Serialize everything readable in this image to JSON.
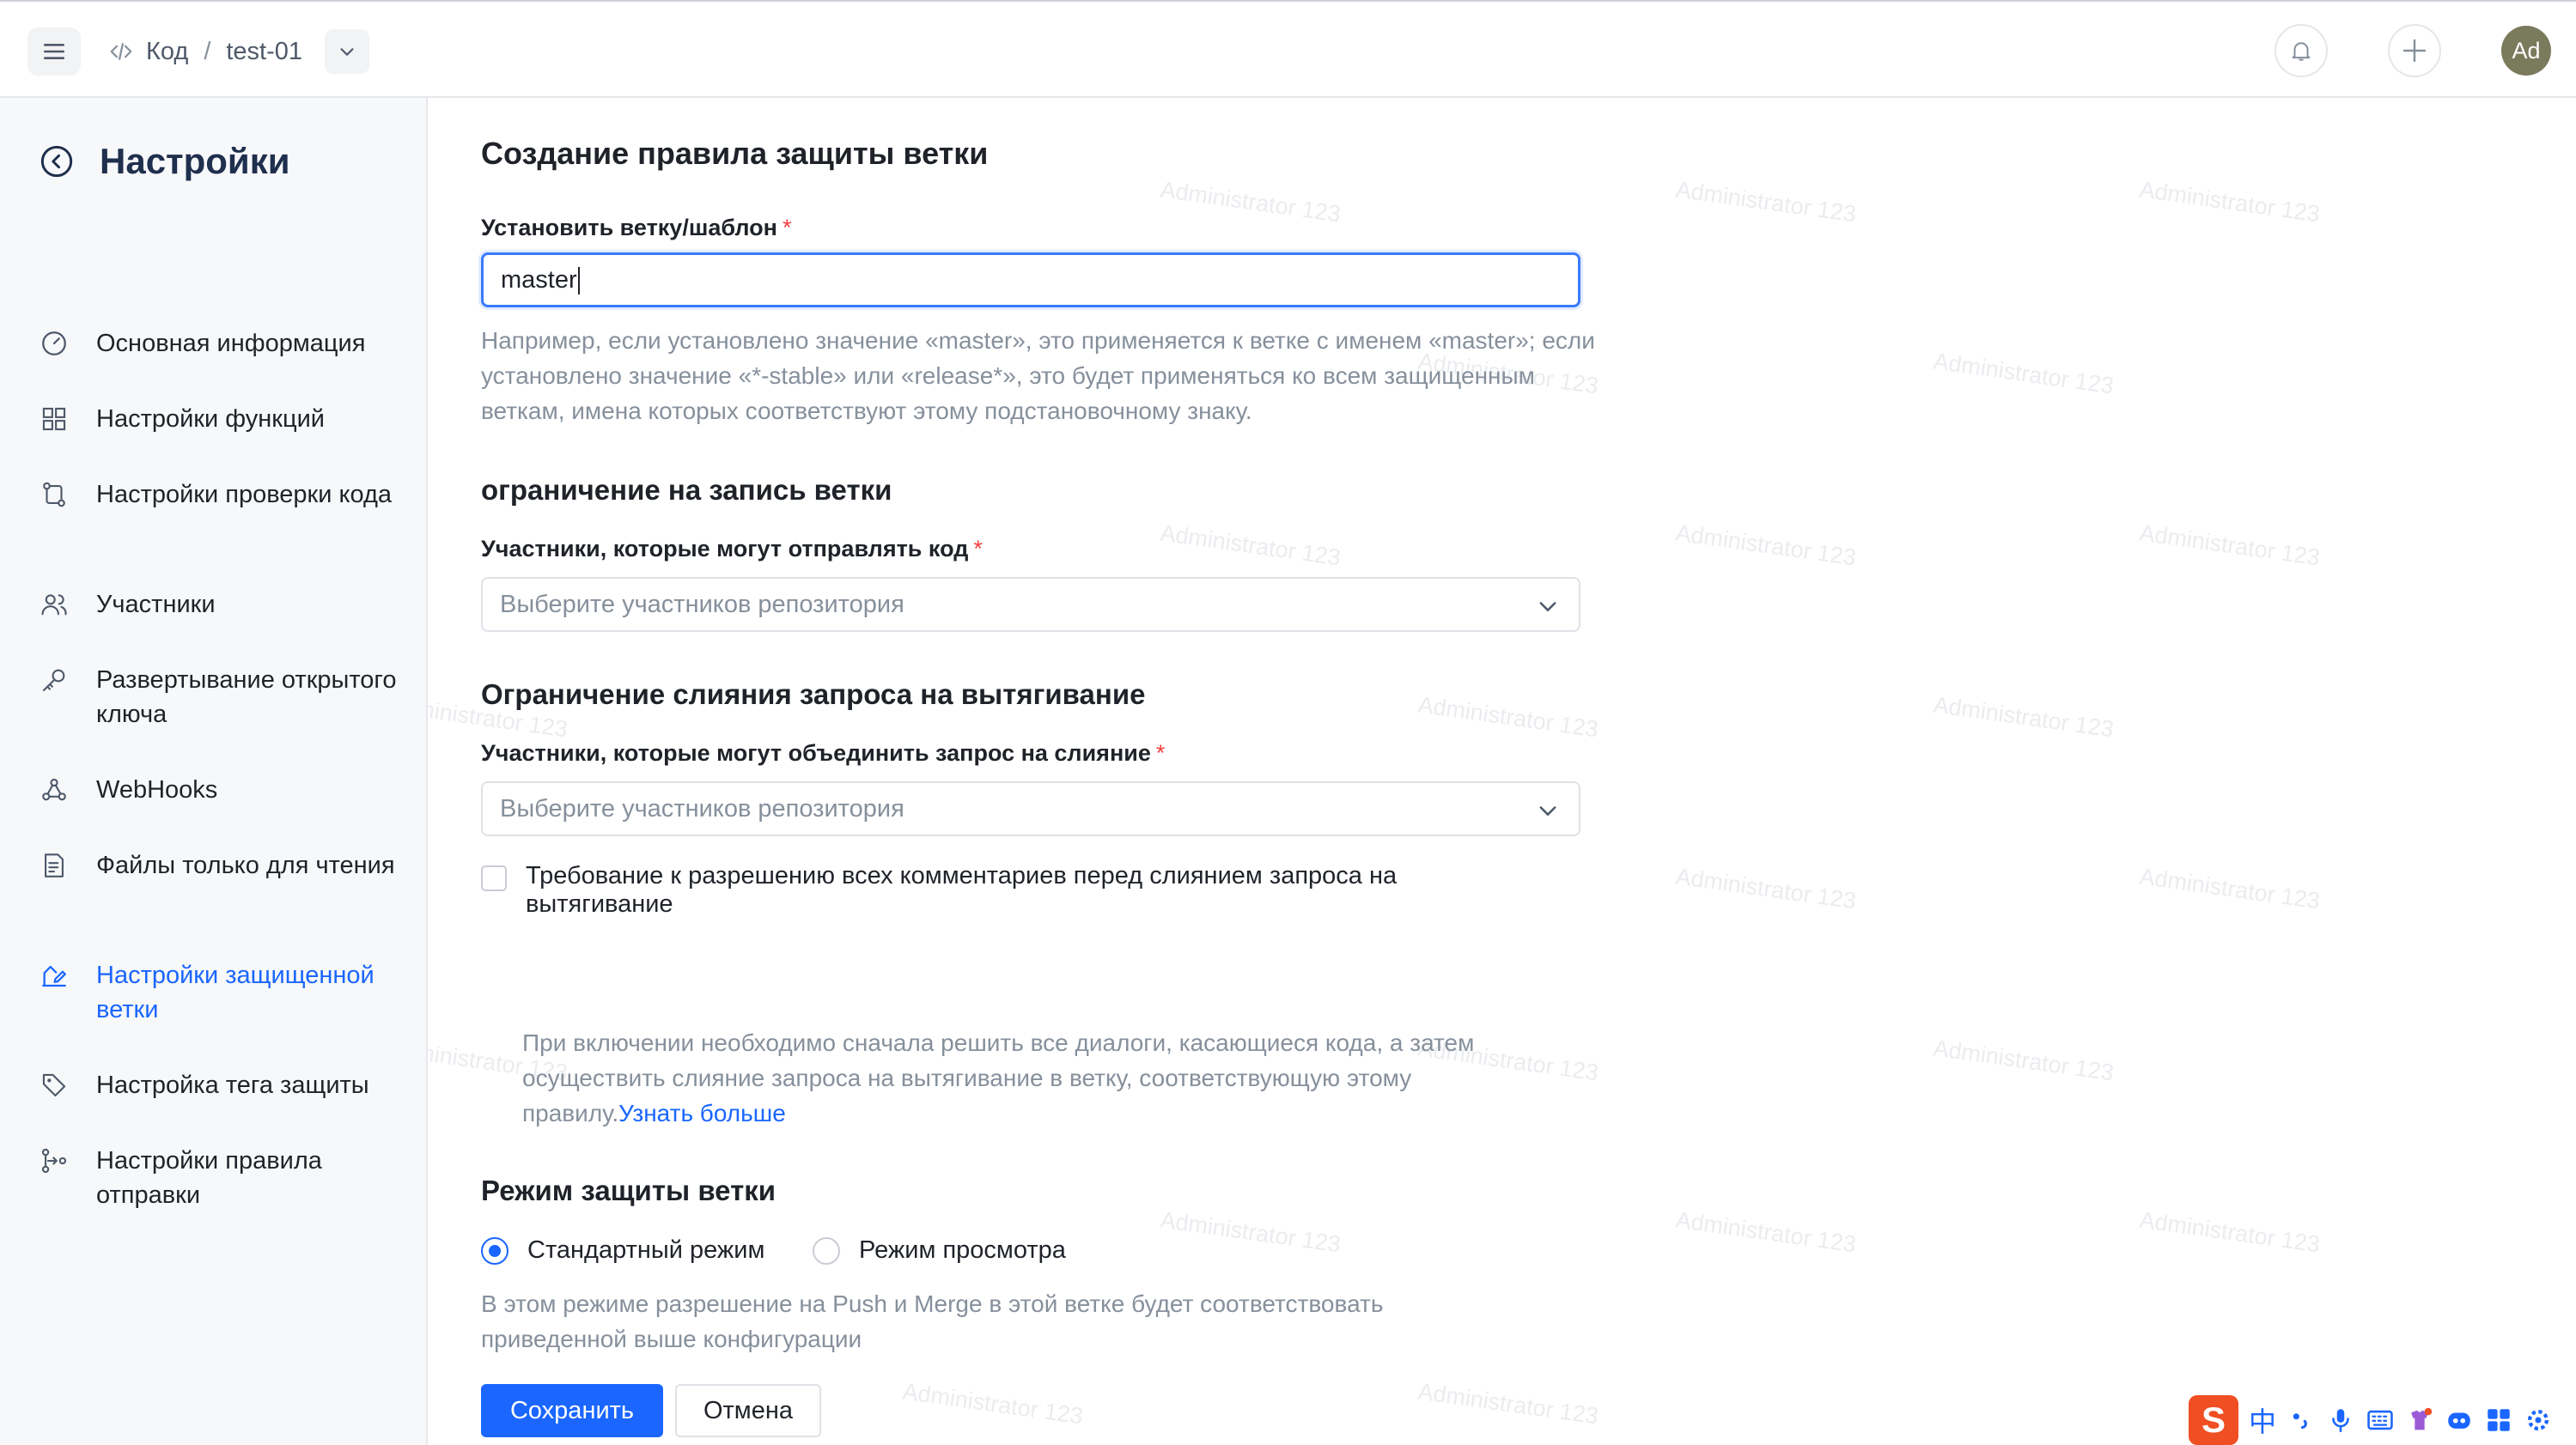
{
  "topbar": {
    "breadcrumb": [
      "Код",
      "test-01"
    ],
    "avatar_initials": "Ad"
  },
  "sidebar": {
    "title": "Настройки",
    "items": [
      {
        "label": "Основная информация",
        "icon": "gauge-icon"
      },
      {
        "label": "Настройки функций",
        "icon": "grid-icon"
      },
      {
        "label": "Настройки проверки кода",
        "icon": "branch-compare-icon"
      },
      {
        "label": "Участники",
        "icon": "users-icon"
      },
      {
        "label": "Развертывание открытого ключа",
        "icon": "key-icon"
      },
      {
        "label": "WebHooks",
        "icon": "webhook-icon"
      },
      {
        "label": "Файлы только для чтения",
        "icon": "readonly-file-icon"
      },
      {
        "label": "Настройки защищенной ветки",
        "icon": "protected-branch-icon",
        "active": true
      },
      {
        "label": "Настройка тега защиты",
        "icon": "tag-icon"
      },
      {
        "label": "Настройки правила отправки",
        "icon": "push-rule-icon"
      }
    ]
  },
  "form": {
    "title": "Создание правила защиты ветки",
    "branch_label": "Установить ветку/шаблон",
    "branch_value": "master",
    "branch_help": "Например, если установлено значение «master», это применяется к ветке с именем «master»; если установлено значение «*-stable» или «release*», это будет применяться ко всем защищенным веткам, имена которых соответствуют этому подстановочному знаку.",
    "write_section": "ограничение на запись ветки",
    "push_label": "Участники, которые могут отправлять код",
    "push_placeholder": "Выберите участников репозитория",
    "merge_section": "Ограничение слияния запроса на вытягивание",
    "merge_label": "Участники, которые могут объединить запрос на слияние",
    "merge_placeholder": "Выберите участников репозитория",
    "resolve_checkbox_label": "Требование к разрешению всех комментариев перед слиянием запроса на вытягивание",
    "resolve_checked": false,
    "resolve_help": "При включении необходимо сначала решить все диалоги, касающиеся кода, а затем осуществить слияние запроса на вытягивание в ветку, соответствующую этому правилу.",
    "learn_more": "Узнать больше",
    "mode_section": "Режим защиты ветки",
    "mode_standard": "Стандартный режим",
    "mode_review": "Режим просмотра",
    "mode_selected": "standard",
    "mode_help": "В этом режиме разрешение на Push и Merge в этой ветке будет соответствовать приведенной выше конфигурации",
    "save_button": "Сохранить",
    "cancel_button": "Отмена"
  },
  "watermark": "Administrator 123",
  "ime": {
    "lang": "中"
  },
  "colors": {
    "accent": "#1a66ff",
    "required": "#f53f3f",
    "muted": "#86909c"
  }
}
